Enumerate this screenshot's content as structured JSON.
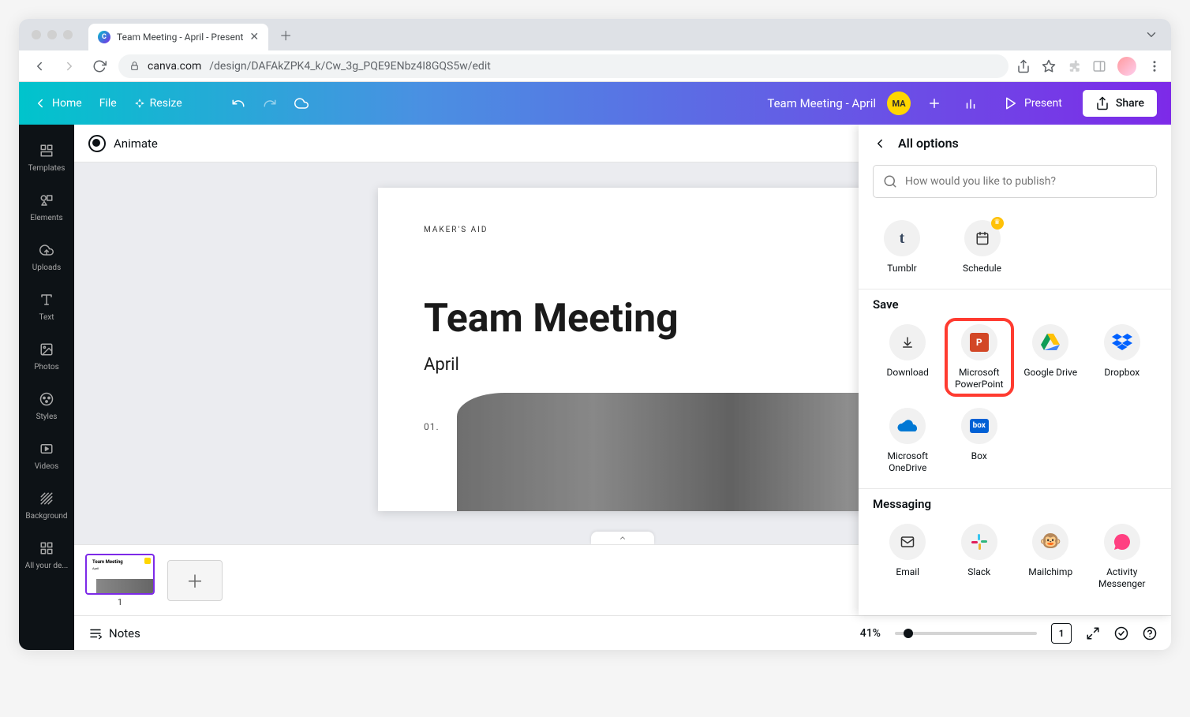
{
  "browser": {
    "tab_title": "Team Meeting - April - Present",
    "url_host": "canva.com",
    "url_path": "/design/DAFAkZPK4_k/Cw_3g_PQE9ENbz4I8GQS5w/edit"
  },
  "header": {
    "home": "Home",
    "file": "File",
    "resize": "Resize",
    "doc_title": "Team Meeting - April",
    "avatar_initials": "MA",
    "present": "Present",
    "share": "Share"
  },
  "sidebar": {
    "items": [
      {
        "label": "Templates"
      },
      {
        "label": "Elements"
      },
      {
        "label": "Uploads"
      },
      {
        "label": "Text"
      },
      {
        "label": "Photos"
      },
      {
        "label": "Styles"
      },
      {
        "label": "Videos"
      },
      {
        "label": "Background"
      },
      {
        "label": "All your de..."
      }
    ]
  },
  "toolbar": {
    "animate": "Animate"
  },
  "slide": {
    "tag": "MAKER'S AID",
    "title": "Team Meeting",
    "subtitle": "April",
    "number": "01."
  },
  "thumbnails": {
    "page": "1"
  },
  "footer": {
    "notes": "Notes",
    "zoom": "41%",
    "page_indicator": "1"
  },
  "share_panel": {
    "back_title": "All options",
    "search_placeholder": "How would you like to publish?",
    "top_row": [
      {
        "label": "Tumblr",
        "icon": "t"
      },
      {
        "label": "Schedule",
        "icon": "📅",
        "badge": true
      }
    ],
    "save_title": "Save",
    "save_options": [
      {
        "label": "Download"
      },
      {
        "label": "Microsoft PowerPoint",
        "highlighted": true
      },
      {
        "label": "Google Drive"
      },
      {
        "label": "Dropbox"
      },
      {
        "label": "Microsoft OneDrive"
      },
      {
        "label": "Box"
      }
    ],
    "messaging_title": "Messaging",
    "messaging_options": [
      {
        "label": "Email"
      },
      {
        "label": "Slack"
      },
      {
        "label": "Mailchimp"
      },
      {
        "label": "Activity Messenger"
      }
    ]
  }
}
